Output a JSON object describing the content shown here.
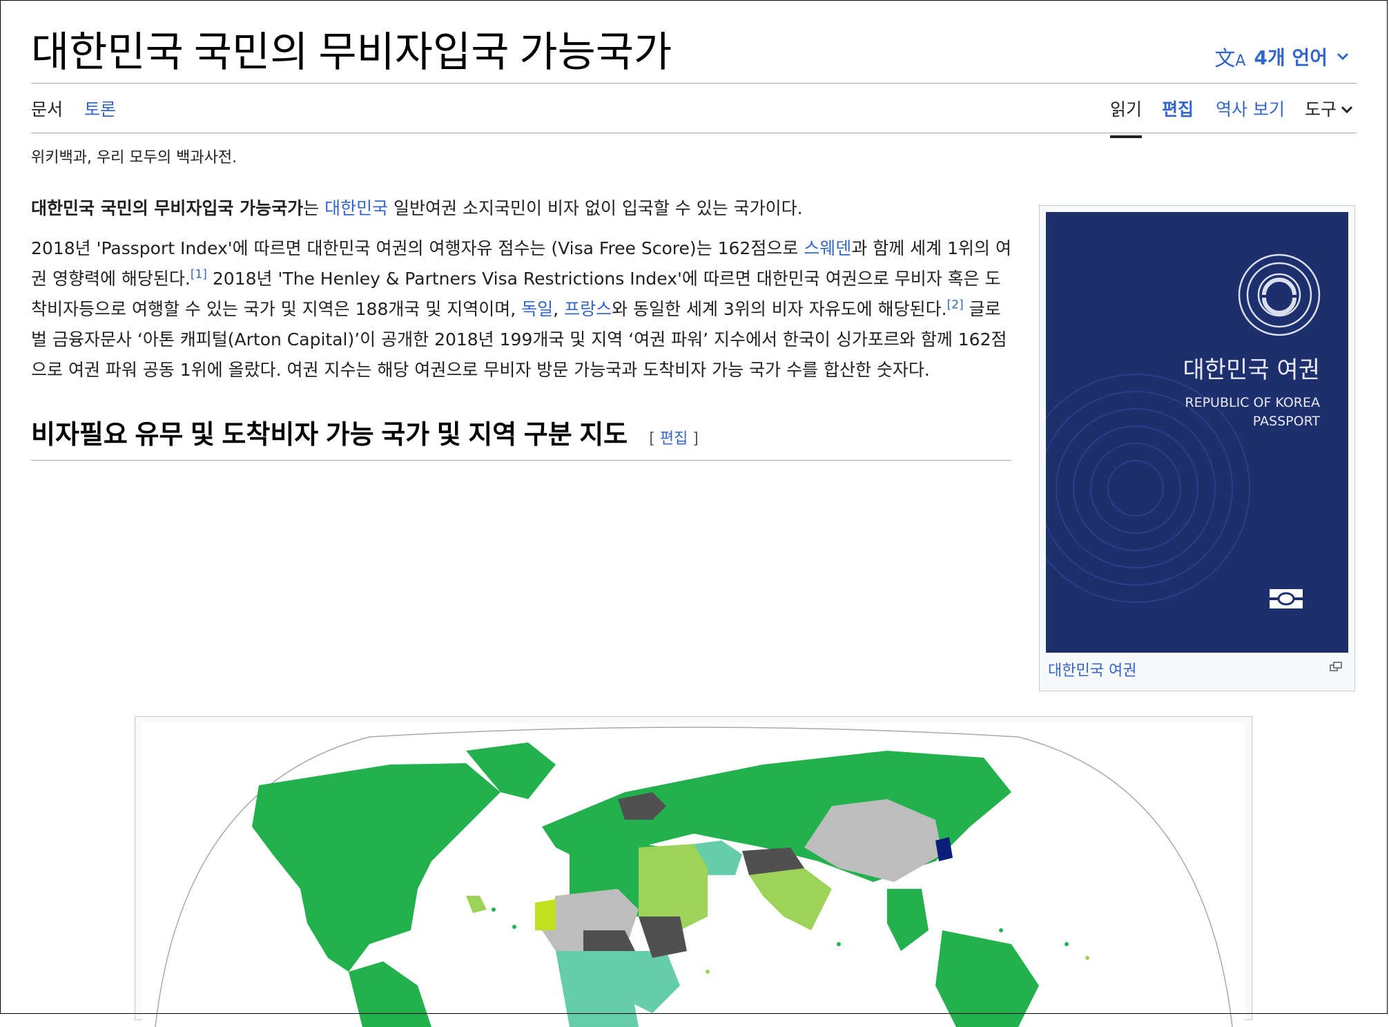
{
  "page": {
    "title": "대한민국 국민의 무비자입국 가능국가",
    "language_button": "4개 언어",
    "tagline": "위키백과, 우리 모두의 백과사전."
  },
  "tabs": {
    "document": "문서",
    "talk": "토론",
    "read": "읽기",
    "edit": "편집",
    "history": "역사 보기",
    "tools": "도구"
  },
  "content": {
    "p1": {
      "bold": "대한민국 국민의 무비자입국 가능국가",
      "t1": "는 ",
      "link": "대한민국",
      "t2": " 일반여권 소지국민이 비자 없이 입국할 수 있는 국가이다."
    },
    "p2": {
      "t1": "2018년 'Passport Index'에 따르면 대한민국 여권의 여행자유 점수는 (Visa Free Score)는 162점으로 ",
      "link1": "스웨덴",
      "t2": "과 함께 세계 1위의 여권 영향력에 해당된다.",
      "ref1": "[1]",
      "t3": " 2018년 'The Henley & Partners Visa Restrictions Index'에 따르면 대한민국 여권으로 무비자 혹은 도착비자등으로 여행할 수 있는 국가 및 지역은 188개국 및 지역이며, ",
      "link2": "독일",
      "t4": ", ",
      "link3": "프랑스",
      "t5": "와 동일한 세계 3위의 비자 자유도에 해당된다.",
      "ref2": "[2]",
      "t6": " 글로벌 금융자문사 ‘아톤 캐피털(Arton Capital)’이 공개한 2018년 199개국 및 지역 ‘여권 파워’ 지수에서 한국이 싱가포르와 함께 162점으로 여권 파워 공동 1위에 올랐다. 여권 지수는 해당 여권으로 무비자 방문 가능국과 도착비자 가능 국가 수를 합산한 숫자다."
    }
  },
  "section": {
    "heading": "비자필요 유무 및 도착비자 가능 국가 및 지역 구분 지도",
    "edit_open": "[ ",
    "edit_label": "편집",
    "edit_close": " ]"
  },
  "infobox": {
    "caption": "대한민국 여권",
    "passport_title": "대한민국 여권",
    "passport_line1": "REPUBLIC OF KOREA",
    "passport_line2": "PASSPORT"
  },
  "colors": {
    "link": "#3366cc",
    "passport_blue": "#1e2f6e",
    "visa_free": "#22b14c",
    "visa_on_arrival": "#9ed35a",
    "eta": "#66cdaa",
    "visa_required": "#bdbdbd",
    "restricted": "#505050",
    "home_country": "#0a1f7a"
  }
}
